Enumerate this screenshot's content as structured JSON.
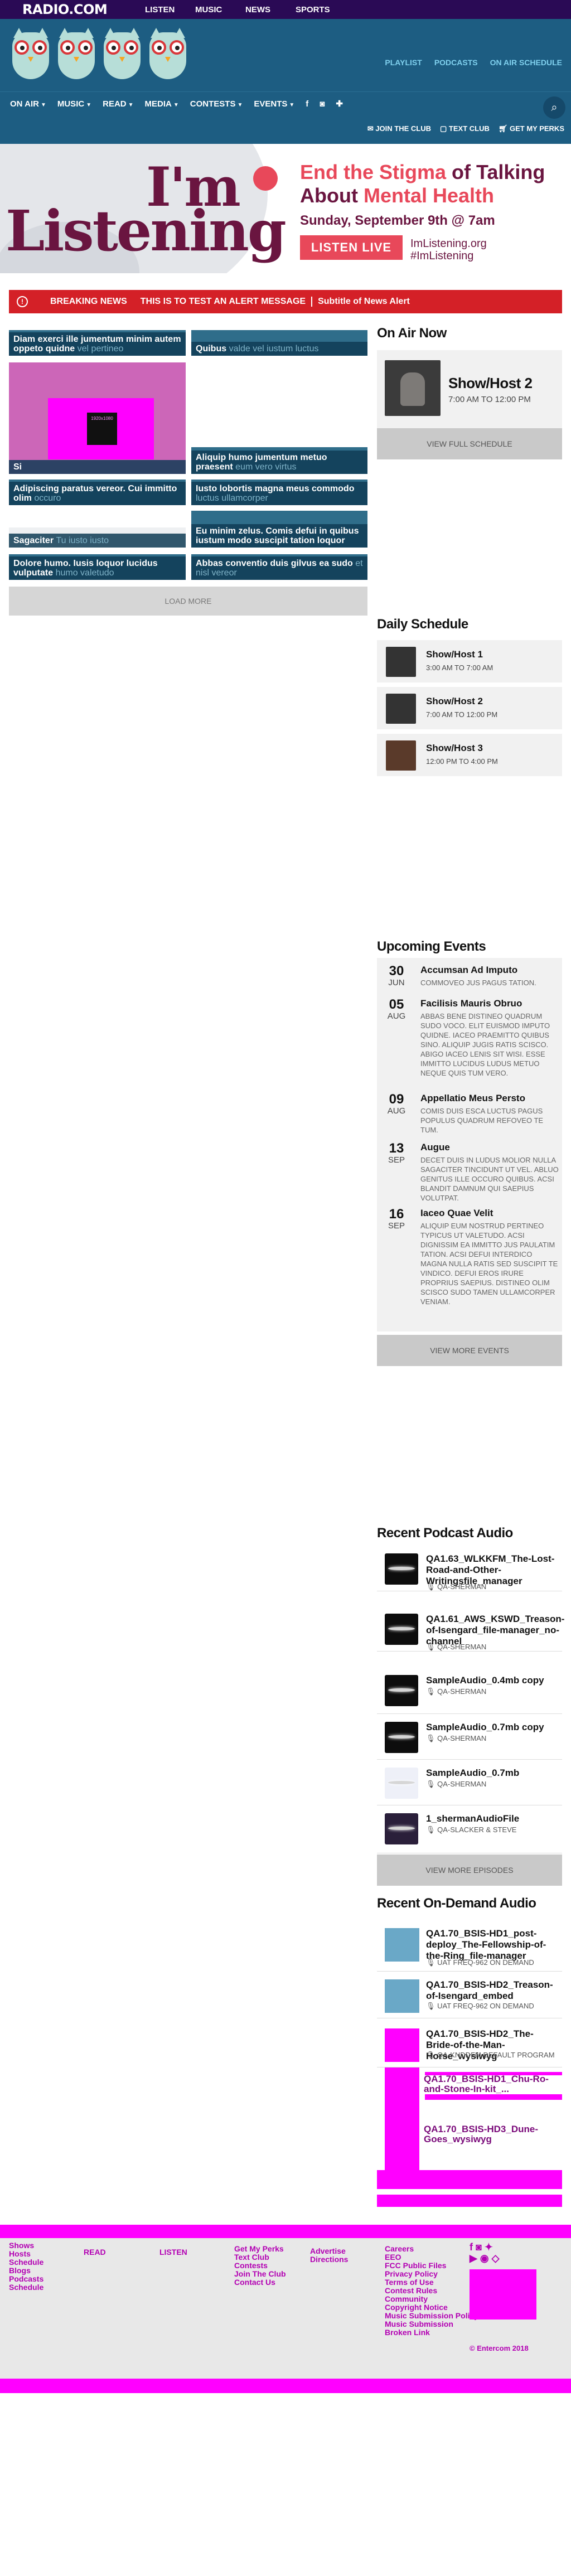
{
  "brand": {
    "logo": "RADIO.COM"
  },
  "topnav": [
    "LISTEN",
    "MUSIC",
    "NEWS",
    "SPORTS"
  ],
  "header": {
    "links": [
      "PLAYLIST",
      "PODCASTS",
      "ON AIR SCHEDULE"
    ]
  },
  "mainnav": {
    "items": [
      "ON AIR",
      "MUSIC",
      "READ",
      "MEDIA",
      "CONTESTS",
      "EVENTS"
    ],
    "perks": [
      "JOIN THE CLUB",
      "TEXT CLUB",
      "GET MY PERKS"
    ]
  },
  "banner": {
    "im": "I'm",
    "listening": "Listening",
    "reg": "®",
    "headline_a": "End the Stigma",
    "headline_b": " of Talking About ",
    "headline_c": "Mental Health",
    "date": "Sunday, September 9th @ 7am",
    "button": "LISTEN LIVE",
    "url": "ImListening.org",
    "hashtag": "#ImListening"
  },
  "alert": {
    "label": "BREAKING NEWS",
    "message": "THIS IS TO TEST AN ALERT MESSAGE",
    "subtitle": "Subtitle of News Alert"
  },
  "tiles": [
    {
      "title": "Diam exerci ille jumentum minim autem oppeto quidne",
      "ghost": "vel pertineo"
    },
    {
      "title": "Quibus",
      "ghost": "valde vel iustum luctus"
    },
    {
      "title": "Si",
      "ghost": ""
    },
    {
      "title": "Aliquip humo jumentum metuo praesent",
      "ghost": "eum vero virtus"
    },
    {
      "title": "Adipiscing paratus vereor. Cui immitto olim",
      "ghost": "occuro"
    },
    {
      "title": "Iusto lobortis magna meus commodo",
      "ghost": "luctus ullamcorper"
    },
    {
      "title": "Sagaciter",
      "ghost": "Tu iusto iusto"
    },
    {
      "title": "Eu minim zelus. Comis defui in quibus iustum modo suscipit tation loquor",
      "ghost": ""
    },
    {
      "title": "Dolore humo. Iusis loquor lucidus vulputate",
      "ghost": "humo valetudo"
    },
    {
      "title": "Abbas conventio duis gilvus ea sudo",
      "ghost": "et nisl vereor"
    }
  ],
  "tile_inner_text": "1920x1080",
  "load_more": "LOAD MORE",
  "on_air": {
    "heading": "On Air Now",
    "show": "Show/Host 2",
    "time": "7:00 AM TO 12:00 PM",
    "button": "VIEW FULL SCHEDULE"
  },
  "daily": {
    "heading": "Daily Schedule",
    "items": [
      {
        "name": "Show/Host 1",
        "time": "3:00 AM TO 7:00 AM"
      },
      {
        "name": "Show/Host 2",
        "time": "7:00 AM TO 12:00 PM"
      },
      {
        "name": "Show/Host 3",
        "time": "12:00 PM TO 4:00 PM"
      }
    ]
  },
  "events": {
    "heading": "Upcoming Events",
    "items": [
      {
        "day": "30",
        "month": "JUN",
        "title": "Accumsan Ad Imputo",
        "desc": "COMMOVEO JUS PAGUS TATION."
      },
      {
        "day": "05",
        "month": "AUG",
        "title": "Facilisis Mauris Obruo",
        "desc": "ABBAS BENE DISTINEO QUADRUM SUDO VOCO. ELIT EUISMOD IMPUTO QUIDNE. IACEO PRAEMITTO QUIBUS SINO. ALIQUIP JUGIS RATIS SCISCO. ABIGO IACEO LENIS SIT WISI. ESSE IMMITTO LUCIDUS LUDUS METUO NEQUE QUIS TUM VERO."
      },
      {
        "day": "09",
        "month": "AUG",
        "title": "Appellatio Meus Persto",
        "desc": "COMIS DUIS ESCA LUCTUS PAGUS POPULUS QUADRUM REFOVEO TE TUM."
      },
      {
        "day": "13",
        "month": "SEP",
        "title": "Augue",
        "desc": "DECET DUIS IN LUDUS MOLIOR NULLA SAGACITER TINCIDUNT UT VEL. ABLUO GENITUS ILLE OCCURO QUIBUS. ACSI BLANDIT DAMNUM QUI SAEPIUS VOLUTPAT."
      },
      {
        "day": "16",
        "month": "SEP",
        "title": "Iaceo Quae Velit",
        "desc": "ALIQUIP EUM NOSTRUD PERTINEO TYPICUS UT VALETUDO. ACSI DIGNISSIM EA IMMITTO JUS PAULATIM TATION. ACSI DEFUI INTERDICO MAGNA NULLA RATIS SED SUSCIPIT TE VINDICO. DEFUI EROS IRURE PROPRIUS SAEPIUS. DISTINEO OLIM SCISCO SUDO TAMEN ULLAMCORPER VENIAM."
      }
    ],
    "button": "VIEW MORE EVENTS"
  },
  "podcasts": {
    "heading": "Recent Podcast Audio",
    "items": [
      {
        "name": "QA1.63_WLKKFM_The-Lost-Road-and-Other-Writingsfile_manager",
        "by": "QA-SHERMAN"
      },
      {
        "name": "QA1.61_AWS_KSWD_Treason-of-Isengard_file-manager_no-channel",
        "by": "QA-SHERMAN"
      },
      {
        "name": "SampleAudio_0.4mb copy",
        "by": "QA-SHERMAN"
      },
      {
        "name": "SampleAudio_0.7mb copy",
        "by": "QA-SHERMAN"
      },
      {
        "name": "SampleAudio_0.7mb",
        "by": "QA-SHERMAN"
      },
      {
        "name": "1_shermanAudioFile",
        "by": "QA-SLACKER & STEVE"
      }
    ],
    "button": "VIEW MORE EPISODES"
  },
  "ondemand": {
    "heading": "Recent On-Demand Audio",
    "items": [
      {
        "name": "QA1.70_BSIS-HD1_post-deploy_The-Fellowship-of-the-Ring_file-manager",
        "by": "UAT FREQ-962 ON DEMAND"
      },
      {
        "name": "QA1.70_BSIS-HD2_Treason-of-Isengard_embed",
        "by": "UAT FREQ-962 ON DEMAND"
      },
      {
        "name": "QA1.70_BSIS-HD2_The-Bride-of-the-Man-Horse_wysiwyg",
        "by": "QA-KNDDFM DEFAULT PROGRAM"
      }
    ],
    "overlap_names": [
      "QA1.70_BSIS-HD1_Chu-Ro-and-Stone-In-kit_...",
      "QA1.70_BSIS-HD3_Dune-Goes_wysiwyg"
    ]
  },
  "footer": {
    "col1": [
      "Shows",
      "Hosts",
      "Schedule",
      "Blogs",
      "Podcasts",
      "Schedule"
    ],
    "col2": [
      "READ"
    ],
    "col3": [
      "LISTEN"
    ],
    "col4": [
      "Get My Perks",
      "Text Club",
      "Contests",
      "Join The Club",
      "Contact Us"
    ],
    "col5": [
      "Advertise",
      "Directions"
    ],
    "col6": [
      "Careers",
      "EEO",
      "FCC Public Files",
      "Privacy Policy",
      "Terms of Use",
      "Contest Rules",
      "Community",
      "Copyright Notice",
      "Music Submission Policy",
      "Music Submission",
      "Broken Link"
    ],
    "copyright": "© Entercom 2018"
  }
}
